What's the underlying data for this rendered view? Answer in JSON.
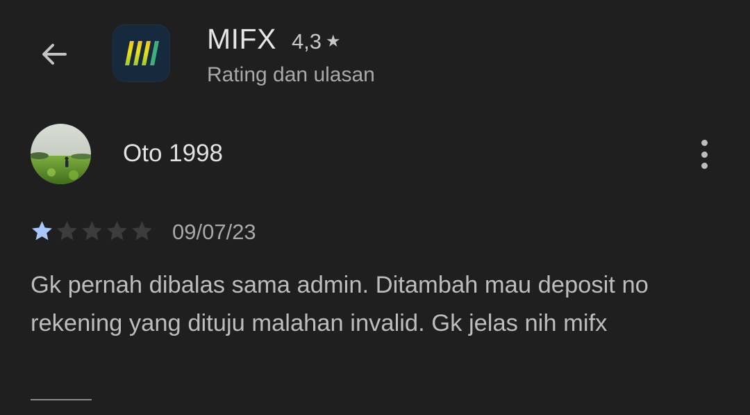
{
  "header": {
    "app_name": "MIFX",
    "app_rating": "4,3",
    "subtitle": "Rating dan ulasan"
  },
  "review": {
    "reviewer_name": "Oto 1998",
    "rating": 1,
    "rating_max": 5,
    "date": "09/07/23",
    "text": "Gk pernah dibalas sama admin. Ditambah mau deposit no rekening yang dituju malahan invalid. Gk jelas nih mifx"
  },
  "icons": {
    "back": "arrow-back-icon",
    "more": "more-vert-icon",
    "rating_star": "star-icon"
  },
  "colors": {
    "background": "#1f1f1f",
    "star_filled": "#a8c7fa",
    "star_empty": "#3c3c3c",
    "app_icon_bg": "#17293d"
  }
}
